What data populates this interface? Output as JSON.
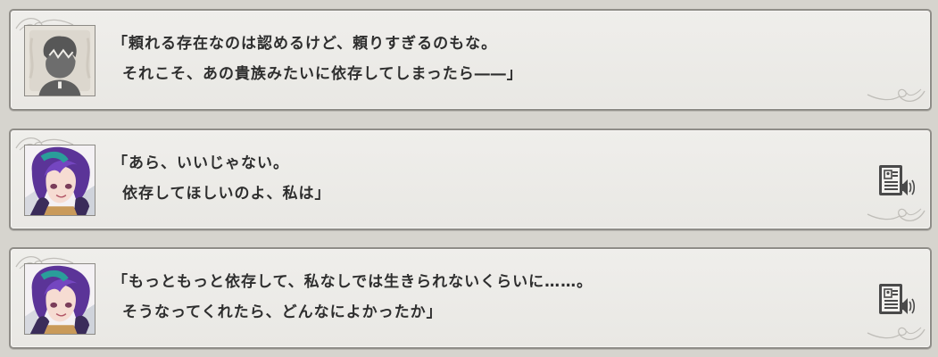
{
  "backlog": {
    "entries": [
      {
        "speaker_avatar": "silhouette-avatar",
        "line1": "「頼れる存在なのは認めるけど、頼りすぎるのもな。",
        "line2": "それこそ、あの貴族みたいに依存してしまったら――」",
        "has_voice": false
      },
      {
        "speaker_avatar": "purple-haired-girl-avatar",
        "line1": "「あら、いいじゃない。",
        "line2": "依存してほしいのよ、私は」",
        "has_voice": true,
        "voice_icon": "voice-replay-icon"
      },
      {
        "speaker_avatar": "purple-haired-girl-avatar",
        "line1": "「もっともっと依存して、私なしでは生きられないくらいに……。",
        "line2": "そうなってくれたら、どんなによかったか」",
        "has_voice": true,
        "voice_icon": "voice-replay-icon"
      }
    ]
  },
  "colors": {
    "background": "#d6d4ce",
    "panel": "#edecE8",
    "border": "#8f8d88",
    "text": "#2e2e2e",
    "hair": "#6a3fb0"
  }
}
